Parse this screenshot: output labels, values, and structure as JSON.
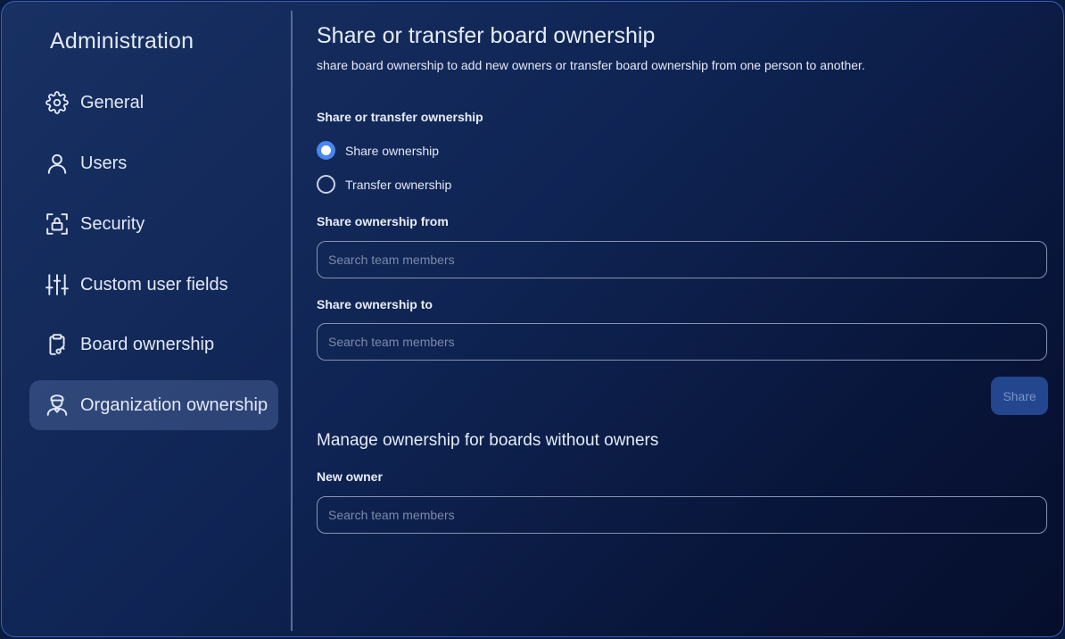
{
  "sidebar": {
    "title": "Administration",
    "items": [
      {
        "label": "General",
        "icon": "gear-icon"
      },
      {
        "label": "Users",
        "icon": "user-icon"
      },
      {
        "label": "Security",
        "icon": "lock-icon"
      },
      {
        "label": "Custom user fields",
        "icon": "sliders-icon"
      },
      {
        "label": "Board ownership",
        "icon": "clipboard-key-icon"
      },
      {
        "label": "Organization ownership",
        "icon": "person-badge-icon",
        "active": true
      }
    ]
  },
  "main": {
    "title": "Share or transfer board ownership",
    "subtitle": "share board ownership to add new owners or transfer board ownership from one person to another.",
    "mode_label": "Share or transfer ownership",
    "options": [
      {
        "label": "Share ownership",
        "selected": true
      },
      {
        "label": "Transfer ownership",
        "selected": false
      }
    ],
    "from_label": "Share ownership from",
    "from_placeholder": "Search team members",
    "to_label": "Share ownership to",
    "to_placeholder": "Search team members",
    "share_button": "Share",
    "manage_title": "Manage ownership for boards without owners",
    "new_owner_label": "New owner",
    "new_owner_placeholder": "Search team members"
  },
  "colors": {
    "accent": "#4a86f0",
    "button_bg": "#23468f",
    "text": "#e3e9f5"
  }
}
